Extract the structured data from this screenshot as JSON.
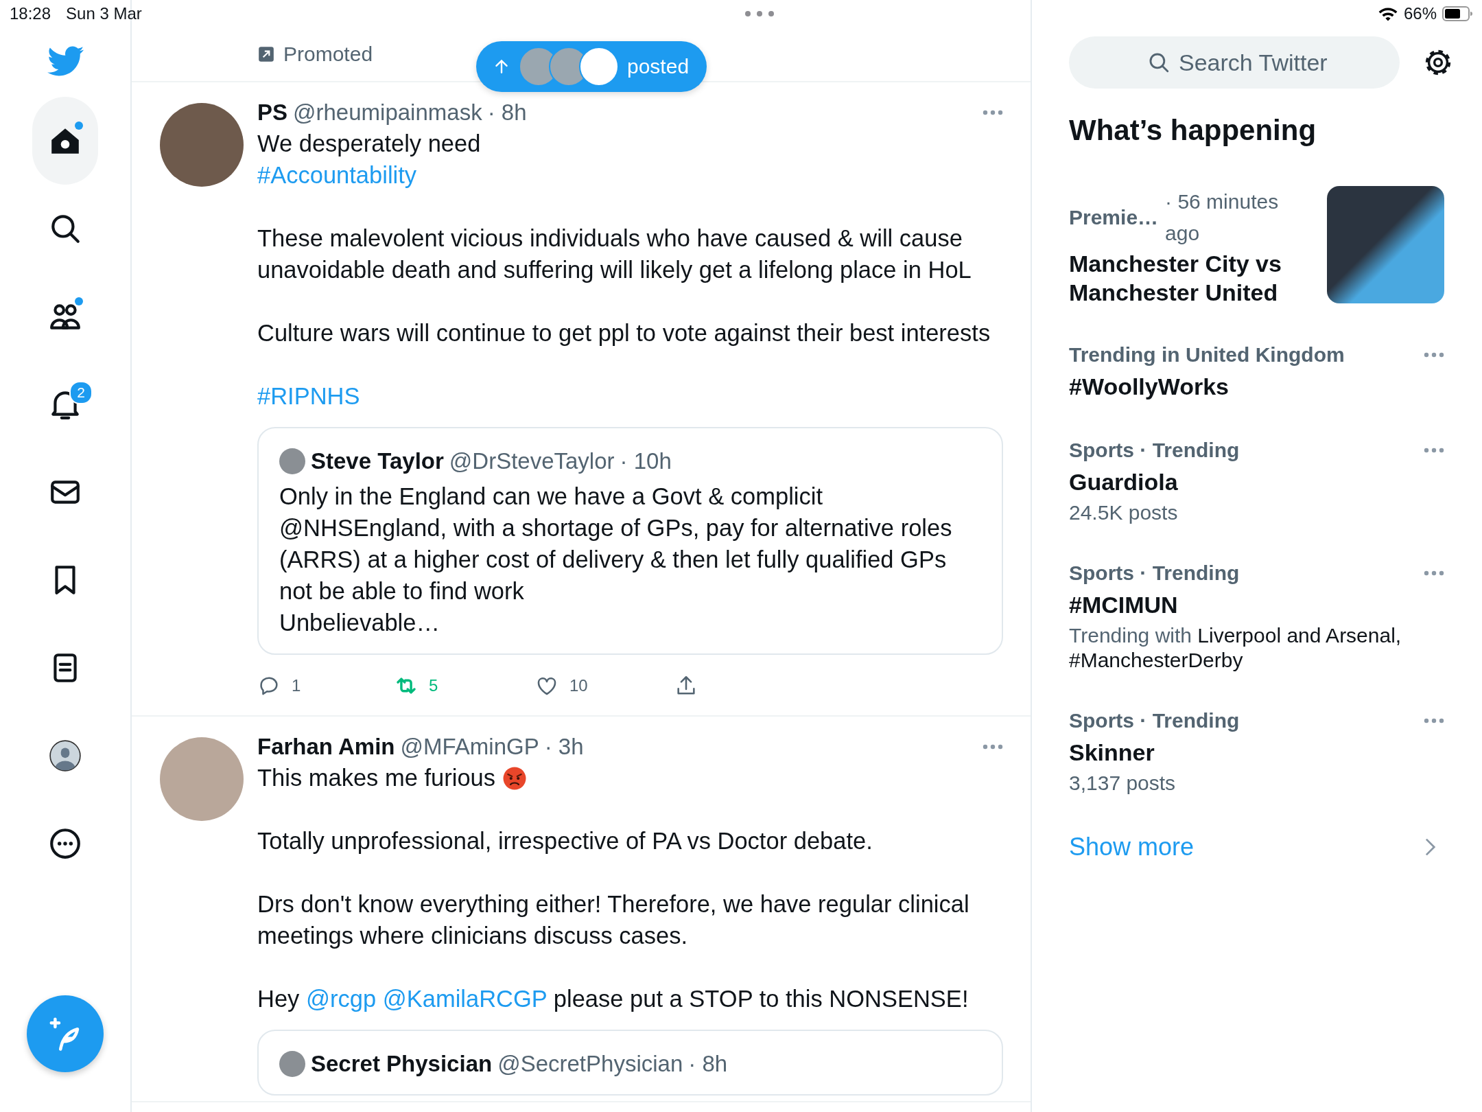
{
  "status_bar": {
    "time": "18:28",
    "date": "Sun 3 Mar",
    "battery": "66%"
  },
  "sidebar": {
    "items": [
      {
        "kind": "home",
        "selected": true,
        "dot": true
      },
      {
        "kind": "explore",
        "selected": false,
        "dot": false
      },
      {
        "kind": "communities",
        "selected": false,
        "dot": true
      },
      {
        "kind": "notifications",
        "selected": false,
        "dot": false,
        "badge": "2"
      },
      {
        "kind": "messages",
        "selected": false,
        "dot": false
      },
      {
        "kind": "bookmarks",
        "selected": false,
        "dot": false
      },
      {
        "kind": "lists",
        "selected": false,
        "dot": false
      },
      {
        "kind": "profile",
        "selected": false,
        "dot": false
      },
      {
        "kind": "more",
        "selected": false,
        "dot": false
      }
    ]
  },
  "main": {
    "promoted": {
      "label": "Promoted"
    },
    "new_posts": {
      "label": "posted",
      "avatars": [
        {
          "kind": "photo"
        },
        {
          "kind": "photo"
        },
        {
          "kind": "logo"
        }
      ]
    },
    "tweets": [
      {
        "name": "PS",
        "handle": "@rheumipainmask",
        "time": "· 8h",
        "paragraphs": [
          [
            {
              "kind": "text",
              "text": "We desperately need\n"
            },
            {
              "kind": "hashtag",
              "text": "#Accountability"
            }
          ],
          [
            {
              "kind": "text",
              "text": "These malevolent vicious individuals who have caused & will cause unavoidable death and suffering will likely get a lifelong place in HoL"
            }
          ],
          [
            {
              "kind": "text",
              "text": "Culture wars will continue to get ppl to vote against their best interests"
            }
          ],
          [
            {
              "kind": "hashtag",
              "text": "#RIPNHS"
            }
          ]
        ],
        "quote": {
          "name": "Steve Taylor",
          "handle": "@DrSteveTaylor",
          "time": "· 10h",
          "text": "Only in the England can we have a Govt & complicit @NHSEngland, with a shortage of GPs, pay for alternative roles (ARRS) at a higher cost of delivery & then let fully qualified GPs not be able to find work\nUnbelievable…"
        },
        "actions": [
          {
            "kind": "reply",
            "count": "1",
            "on": false
          },
          {
            "kind": "retweet",
            "count": "5",
            "on": true
          },
          {
            "kind": "like",
            "count": "10",
            "on": false
          },
          {
            "kind": "share"
          }
        ]
      },
      {
        "name": "Farhan Amin",
        "handle": "@MFAminGP",
        "time": "· 3h",
        "paragraphs": [
          [
            {
              "kind": "text",
              "text": "This makes me furious "
            },
            {
              "kind": "emoji"
            }
          ],
          [
            {
              "kind": "text",
              "text": "Totally unprofessional, irrespective of PA vs Doctor debate."
            }
          ],
          [
            {
              "kind": "text",
              "text": "Drs don't know everything either! Therefore, we have regular clinical meetings where clinicians discuss cases."
            }
          ],
          [
            {
              "kind": "text",
              "text": "Hey "
            },
            {
              "kind": "mention",
              "text": "@rcgp"
            },
            {
              "kind": "mention",
              "text": "@KamilaRCGP"
            },
            {
              "kind": "text",
              "text": " please put a STOP to this NONSENSE!"
            }
          ]
        ],
        "quote": {
          "name": "Secret Physician",
          "handle": "@SecretPhysician",
          "time": "· 8h"
        }
      }
    ]
  },
  "aside": {
    "search": {
      "placeholder": "Search Twitter"
    },
    "heading": "What’s happening",
    "trends": [
      {
        "kind": "news",
        "category": "Premie…",
        "time": "· 56 minutes ago",
        "title": "Manchester City vs Manchester United"
      },
      {
        "kind": "trend",
        "context": "Trending in United Kingdom",
        "title": "#WoollyWorks"
      },
      {
        "kind": "trend",
        "context": "Sports · Trending",
        "title": "Guardiola",
        "meta": [
          {
            "text": "24.5K posts",
            "muted": true
          }
        ]
      },
      {
        "kind": "trend",
        "context": "Sports · Trending",
        "title": "#MCIMUN",
        "meta": [
          {
            "text": "Trending with ",
            "muted": true
          },
          {
            "text": "Liverpool and Arsenal, #ManchesterDerby",
            "muted": false
          }
        ]
      },
      {
        "kind": "trend",
        "context": "Sports · Trending",
        "title": "Skinner",
        "meta": [
          {
            "text": "3,137 posts",
            "muted": true
          }
        ]
      }
    ],
    "show_more": "Show more"
  }
}
